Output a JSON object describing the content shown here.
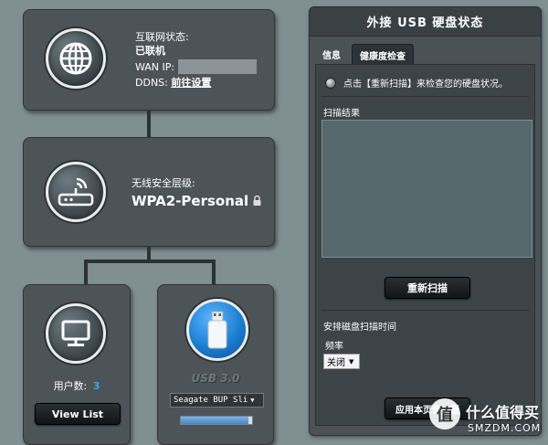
{
  "internet": {
    "status_label": "互联网状态:",
    "status_value": "已联机",
    "wan_label": "WAN IP:",
    "ddns_label": "DDNS:",
    "ddns_link": "前往设置"
  },
  "wireless": {
    "security_label": "无线安全层级:",
    "security_value": "WPA2-Personal"
  },
  "clients": {
    "label": "用户数:",
    "count": "3",
    "button": "View List"
  },
  "usb": {
    "label": "USB 3.0",
    "device": "Seagate BUP Sli",
    "progress": 0.95
  },
  "panel": {
    "title": "外接 USB 硬盘状态",
    "tabs": [
      "信息",
      "健康度检查"
    ],
    "rescan_hint": "点击【重新扫描】来检查您的硬盘状况。",
    "scan_results_label": "扫描结果",
    "rescan_button": "重新扫描",
    "schedule_label": "安排磁盘扫描时间",
    "frequency_label": "频率",
    "frequency_value": "关闭",
    "apply_button": "应用本页面设置"
  },
  "watermark": {
    "text1": "什么值得买",
    "text2": "SMZDM.COM"
  },
  "colors": {
    "accent_blue": "#3da3e8",
    "usb_blue": "#1d7fd1"
  }
}
